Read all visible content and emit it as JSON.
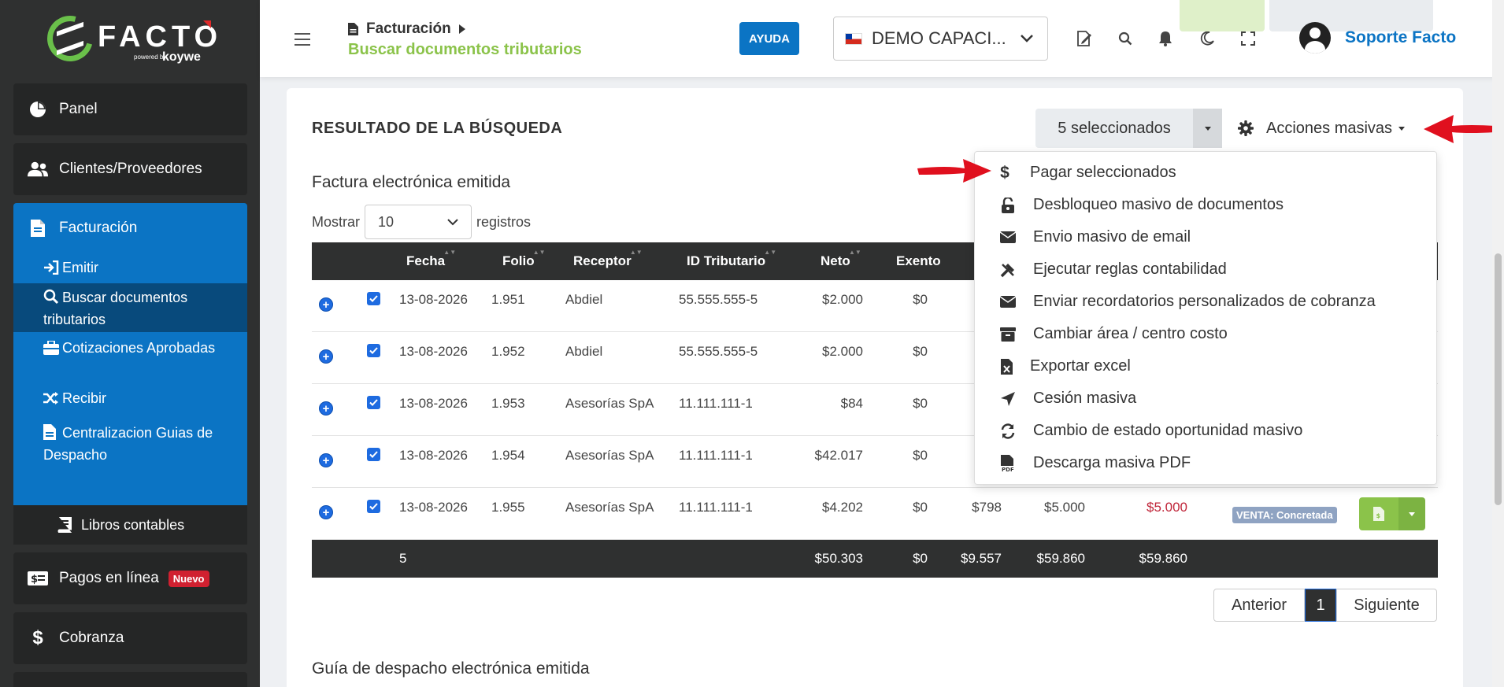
{
  "sidebar": {
    "brand": "FACTO",
    "powered": "powered by",
    "koywe": "koywe",
    "items": [
      {
        "label": "Panel"
      },
      {
        "label": "Clientes/Proveedores"
      },
      {
        "label": "Facturación"
      },
      {
        "label": "Pagos en línea"
      },
      {
        "label": "Cobranza"
      }
    ],
    "new_badge": "Nuevo",
    "sub_items": [
      {
        "label": "Emitir"
      },
      {
        "label": "Buscar documentos tributarios"
      },
      {
        "label": "Cotizaciones Aprobadas"
      },
      {
        "label": "Recibir"
      },
      {
        "label": "Centralizacion Guias de Despacho"
      }
    ],
    "libros": "Libros contables"
  },
  "topbar": {
    "breadcrumb": "Facturación",
    "page_title": "Buscar documentos tributarios",
    "help": "AYUDA",
    "company": "DEMO CAPACI...",
    "user": "Soporte Facto"
  },
  "results": {
    "title": "RESULTADO DE LA BÚSQUEDA",
    "selected": "5 seleccionados",
    "bulk_actions": "Acciones masivas",
    "section": "Factura electrónica emitida",
    "show_label": "Mostrar",
    "show_value": "10",
    "records_label": "registros",
    "columns": [
      "Fecha",
      "Folio",
      "Receptor",
      "ID Tributario",
      "Neto",
      "Exento"
    ],
    "rows": [
      {
        "fecha": "13-08-2026",
        "folio": "1.951",
        "receptor": "Abdiel",
        "id": "55.555.555-5",
        "neto": "$2.000",
        "exento": "$0"
      },
      {
        "fecha": "13-08-2026",
        "folio": "1.952",
        "receptor": "Abdiel",
        "id": "55.555.555-5",
        "neto": "$2.000",
        "exento": "$0"
      },
      {
        "fecha": "13-08-2026",
        "folio": "1.953",
        "receptor": "Asesorías SpA",
        "id": "11.111.111-1",
        "neto": "$84",
        "exento": "$0"
      },
      {
        "fecha": "13-08-2026",
        "folio": "1.954",
        "receptor": "Asesorías SpA",
        "id": "11.111.111-1",
        "neto": "$42.017",
        "exento": "$0"
      },
      {
        "fecha": "13-08-2026",
        "folio": "1.955",
        "receptor": "Asesorías SpA",
        "id": "11.111.111-1",
        "neto": "$4.202",
        "exento": "$0",
        "iva": "$798",
        "total": "$5.000",
        "saldo": "$5.000",
        "estado": "VENTA: Concretada"
      }
    ],
    "totals": {
      "count": "5",
      "neto": "$50.303",
      "exento": "$0",
      "iva": "$9.557",
      "total": "$59.860",
      "saldo": "$59.860"
    },
    "pager": {
      "prev": "Anterior",
      "page": "1",
      "next": "Siguiente"
    },
    "next_section": "Guía de despacho electrónica emitida"
  },
  "dropdown": {
    "items": [
      {
        "label": "Pagar seleccionados",
        "icon": "dollar-icon"
      },
      {
        "label": "Desbloqueo masivo de documentos",
        "icon": "unlock-icon"
      },
      {
        "label": "Envio masivo de email",
        "icon": "envelope-icon"
      },
      {
        "label": "Ejecutar reglas contabilidad",
        "icon": "tools-icon"
      },
      {
        "label": "Enviar recordatorios personalizados de cobranza",
        "icon": "envelope-icon"
      },
      {
        "label": "Cambiar área / centro costo",
        "icon": "archive-icon"
      },
      {
        "label": "Exportar excel",
        "icon": "excel-file-icon"
      },
      {
        "label": "Cesión masiva",
        "icon": "location-arrow-icon"
      },
      {
        "label": "Cambio de estado oportunidad masivo",
        "icon": "sync-icon"
      },
      {
        "label": "Descarga masiva PDF",
        "icon": "pdf-file-icon"
      }
    ]
  },
  "colors": {
    "primary": "#0b74c4",
    "accent_green": "#8bc34a",
    "sidebar": "#2f3030",
    "arrow_red": "#e0101e"
  }
}
